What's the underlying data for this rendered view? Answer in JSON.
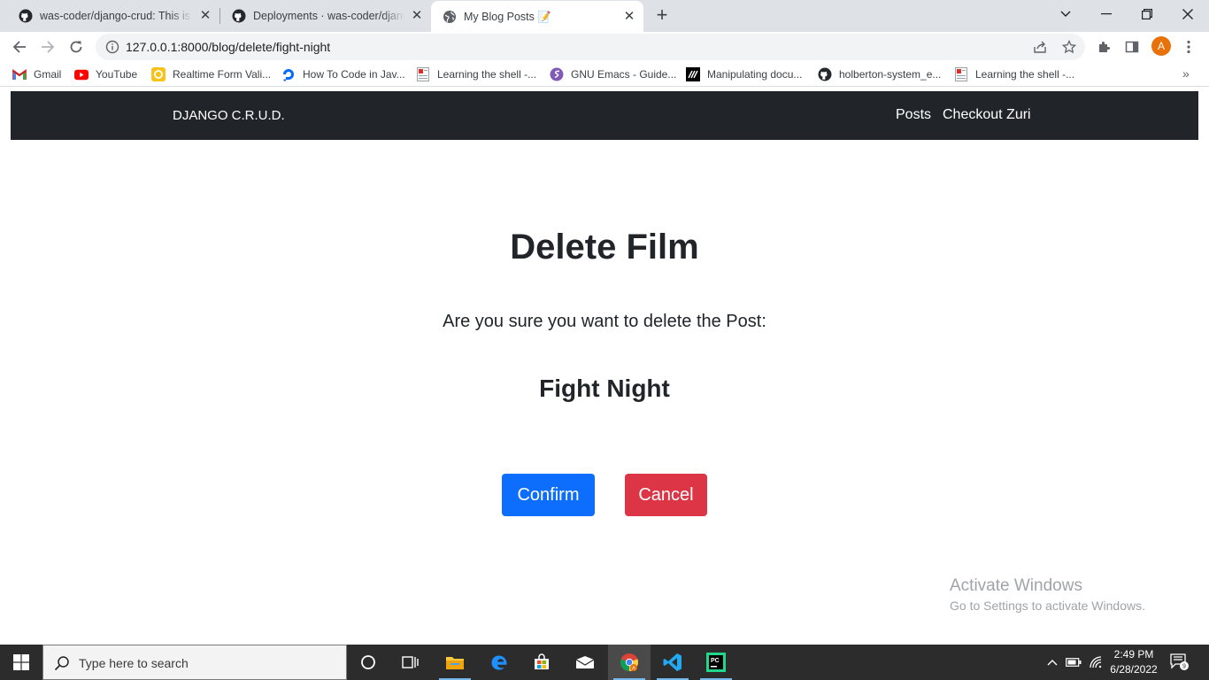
{
  "browser": {
    "tabs": [
      {
        "title": "was-coder/django-crud: This is a",
        "icon": "github-icon"
      },
      {
        "title": "Deployments · was-coder/django",
        "icon": "github-icon"
      },
      {
        "title": "My Blog Posts 📝",
        "icon": "globe-icon",
        "active": true
      }
    ],
    "new_tab": "+",
    "url": "127.0.0.1:8000/blog/delete/fight-night",
    "profile_initial": "A",
    "bookmarks": [
      {
        "label": "Gmail",
        "icon": "gmail-icon"
      },
      {
        "label": "YouTube",
        "icon": "youtube-icon"
      },
      {
        "label": "Realtime Form Vali...",
        "icon": "realtime-form-icon"
      },
      {
        "label": "How To Code in Jav...",
        "icon": "digitalocean-icon"
      },
      {
        "label": "Learning the shell -...",
        "icon": "page-icon"
      },
      {
        "label": "GNU Emacs - Guide...",
        "icon": "emacs-icon"
      },
      {
        "label": "Manipulating docu...",
        "icon": "mdn-icon"
      },
      {
        "label": "holberton-system_e...",
        "icon": "github-icon"
      },
      {
        "label": "Learning the shell -...",
        "icon": "page-icon"
      }
    ],
    "bookmarks_more": "»"
  },
  "site": {
    "brand": "DJANGO C.R.U.D.",
    "nav": [
      "Posts",
      "Checkout Zuri"
    ]
  },
  "main": {
    "heading": "Delete Film",
    "question": "Are you sure you want to delete the Post:",
    "post_title": "Fight Night",
    "confirm_label": "Confirm",
    "cancel_label": "Cancel",
    "confirm_color": "#0d6efd",
    "cancel_color": "#dc3545"
  },
  "watermark": {
    "line1": "Activate Windows",
    "line2": "Go to Settings to activate Windows."
  },
  "taskbar": {
    "search_placeholder": "Type here to search",
    "apps": [
      "cortana-icon",
      "task-view-icon",
      "file-explorer-icon",
      "edge-icon",
      "store-icon",
      "mail-icon",
      "chrome-icon",
      "vscode-icon",
      "pycharm-icon"
    ],
    "time": "2:49 PM",
    "date": "6/28/2022",
    "notification_count": "9"
  }
}
